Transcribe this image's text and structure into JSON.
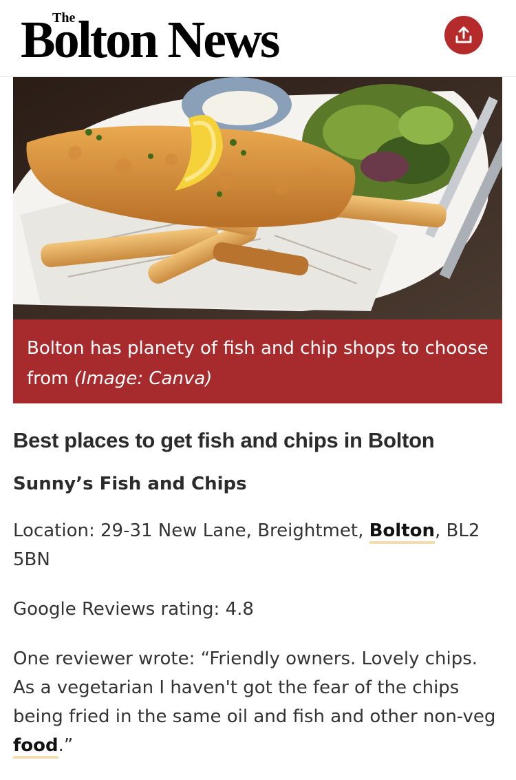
{
  "header": {
    "masthead_small": "The",
    "masthead": "Bolton News",
    "share_icon": "share-upload-icon",
    "brand_color": "#b52a2b"
  },
  "hero": {
    "caption_text": "Bolton has planety of fish and chip shops to choose from",
    "caption_credit": "(Image: Canva)",
    "caption_bg": "#a72a2c"
  },
  "article": {
    "headline": "Best places to get fish and chips in Bolton",
    "shop_name": "Sunny’s Fish and Chips",
    "location_prefix": "Location: 29-31 New Lane, Breightmet, ",
    "location_link": "Bolton",
    "location_suffix": ", BL2 5BN",
    "rating": "Google Reviews rating: 4.8",
    "review_prefix": "One reviewer wrote: “Friendly owners. Lovely chips. As a vegetarian I haven't got the fear of the chips being fried in the same oil and fish and other non-veg ",
    "review_link": "food",
    "review_suffix": ".”"
  }
}
